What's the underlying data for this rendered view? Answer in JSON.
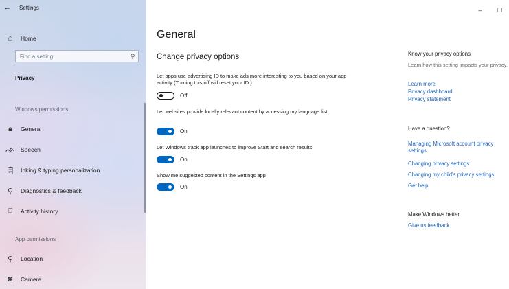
{
  "window": {
    "app_title": "Settings",
    "controls": {
      "minimize": "–",
      "maximize": "☐"
    }
  },
  "sidebar": {
    "home_label": "Home",
    "search_placeholder": "Find a setting",
    "section_title": "Privacy",
    "groups": [
      {
        "label": "Windows permissions",
        "items": [
          {
            "icon": "lock-icon",
            "glyph": "🔒︎",
            "label": "General"
          },
          {
            "icon": "speech-icon",
            "glyph": "ᨒ",
            "label": "Speech"
          },
          {
            "icon": "clipboard-icon",
            "glyph": "📋︎",
            "label": "Inking & typing personalization"
          },
          {
            "icon": "diagnostics-icon",
            "glyph": "⚲",
            "label": "Diagnostics & feedback"
          },
          {
            "icon": "activity-history-icon",
            "glyph": "⌸",
            "label": "Activity history"
          }
        ]
      },
      {
        "label": "App permissions",
        "items": [
          {
            "icon": "location-icon",
            "glyph": "⚲",
            "label": "Location"
          },
          {
            "icon": "camera-icon",
            "glyph": "◙",
            "label": "Camera"
          }
        ]
      }
    ]
  },
  "main": {
    "title": "General",
    "subtitle": "Change privacy options",
    "settings": [
      {
        "text": "Let apps use advertising ID to make ads more interesting to you based on your app activity (Turning this off will reset your ID.)",
        "state": "Off",
        "enabled": false
      },
      {
        "text": "Let websites provide locally relevant content by accessing my language list",
        "state": "On",
        "enabled": true
      },
      {
        "text": "Let Windows track app launches to improve Start and search results",
        "state": "On",
        "enabled": true
      },
      {
        "text": "Show me suggested content in the Settings app",
        "state": "On",
        "enabled": true
      }
    ]
  },
  "right": {
    "know_heading": "Know your privacy options",
    "know_text": "Learn how this setting impacts your privacy.",
    "know_links": [
      "Learn more",
      "Privacy dashboard",
      "Privacy statement"
    ],
    "question_heading": "Have a question?",
    "question_links": [
      "Managing Microsoft account privacy settings",
      "Changing privacy settings",
      "Changing my child's privacy settings",
      "Get help"
    ],
    "better_heading": "Make Windows better",
    "feedback_link": "Give us feedback"
  },
  "colors": {
    "accent": "#0067c0",
    "link": "#1f65b8"
  }
}
